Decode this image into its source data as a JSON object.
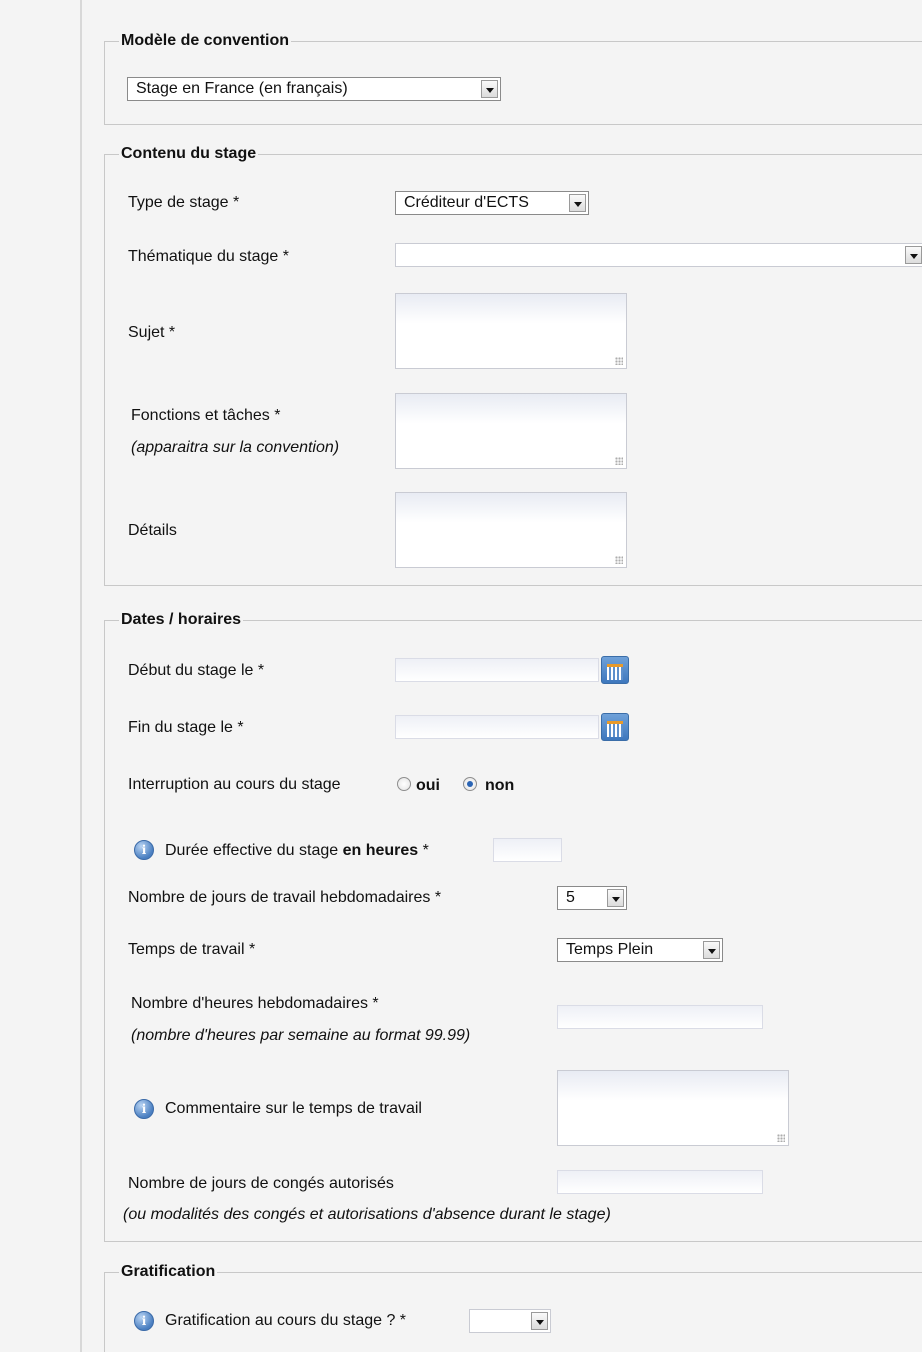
{
  "modele": {
    "legend": "Modèle de convention",
    "selected": "Stage en France (en français)"
  },
  "contenu": {
    "legend": "Contenu du stage",
    "type_label": "Type de stage *",
    "type_value": "Créditeur d'ECTS",
    "thematique_label": "Thématique du stage *",
    "thematique_value": "",
    "sujet_label": "Sujet *",
    "fonctions_label": "Fonctions et tâches *",
    "fonctions_hint": "(apparaitra sur la convention)",
    "details_label": "Détails"
  },
  "dates": {
    "legend": "Dates / horaires",
    "debut_label": "Début du stage le *",
    "fin_label": "Fin du stage le *",
    "interruption_label": "Interruption au cours du stage",
    "oui_label": "oui",
    "non_label": "non",
    "interruption_value": "non",
    "duree_label_pre": "Durée effective du stage",
    "duree_label_bold": "en heures",
    "duree_label_post": "*",
    "jours_label": "Nombre de jours de travail hebdomadaires *",
    "jours_value": "5",
    "temps_label": "Temps de travail *",
    "temps_value": "Temps Plein",
    "heures_label": "Nombre d'heures hebdomadaires *",
    "heures_hint": "(nombre d'heures par semaine au format 99.99)",
    "commentaire_label": "Commentaire sur le temps de travail",
    "conges_label": "Nombre de jours de congés autorisés",
    "conges_hint": "(ou modalités des congés et autorisations d'absence durant le stage)"
  },
  "gratification": {
    "legend": "Gratification",
    "label": "Gratification au cours du stage ? *",
    "value": ""
  }
}
